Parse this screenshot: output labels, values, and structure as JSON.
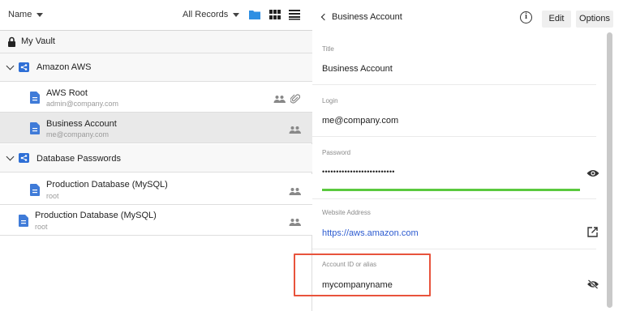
{
  "toolbar": {
    "sort_label": "Name",
    "filter_label": "All Records",
    "icons": [
      "folder-icon",
      "grid-view-icon",
      "list-view-icon"
    ]
  },
  "vault": {
    "label": "My Vault",
    "icon": "lock-icon"
  },
  "folders": [
    {
      "name": "Amazon AWS",
      "records": [
        {
          "title": "AWS Root",
          "subtitle": "admin@company.com",
          "shared": true,
          "attachment": true
        },
        {
          "title": "Business Account",
          "subtitle": "me@company.com",
          "shared": true,
          "selected": true
        }
      ]
    },
    {
      "name": "Database Passwords",
      "records": [
        {
          "title": "Production Database (MySQL)",
          "subtitle": "root",
          "shared": true
        }
      ]
    }
  ],
  "loose_records": [
    {
      "title": "Production Database (MySQL)",
      "subtitle": "root",
      "shared": true
    }
  ],
  "detail": {
    "back_label": "Business Account",
    "edit_label": "Edit",
    "options_label": "Options",
    "fields": {
      "title": {
        "label": "Title",
        "value": "Business Account"
      },
      "login": {
        "label": "Login",
        "value": "me@company.com"
      },
      "password": {
        "label": "Password",
        "value": "••••••••••••••••••••••••••",
        "strength": 1.0
      },
      "website": {
        "label": "Website Address",
        "value": "https://aws.amazon.com"
      },
      "account_id": {
        "label": "Account ID or alias",
        "value": "mycompanyname"
      }
    }
  },
  "colors": {
    "accent": "#2e6fd6",
    "strength": "#5ac93e",
    "highlight": "#e8533c",
    "link": "#2c5bd0"
  }
}
